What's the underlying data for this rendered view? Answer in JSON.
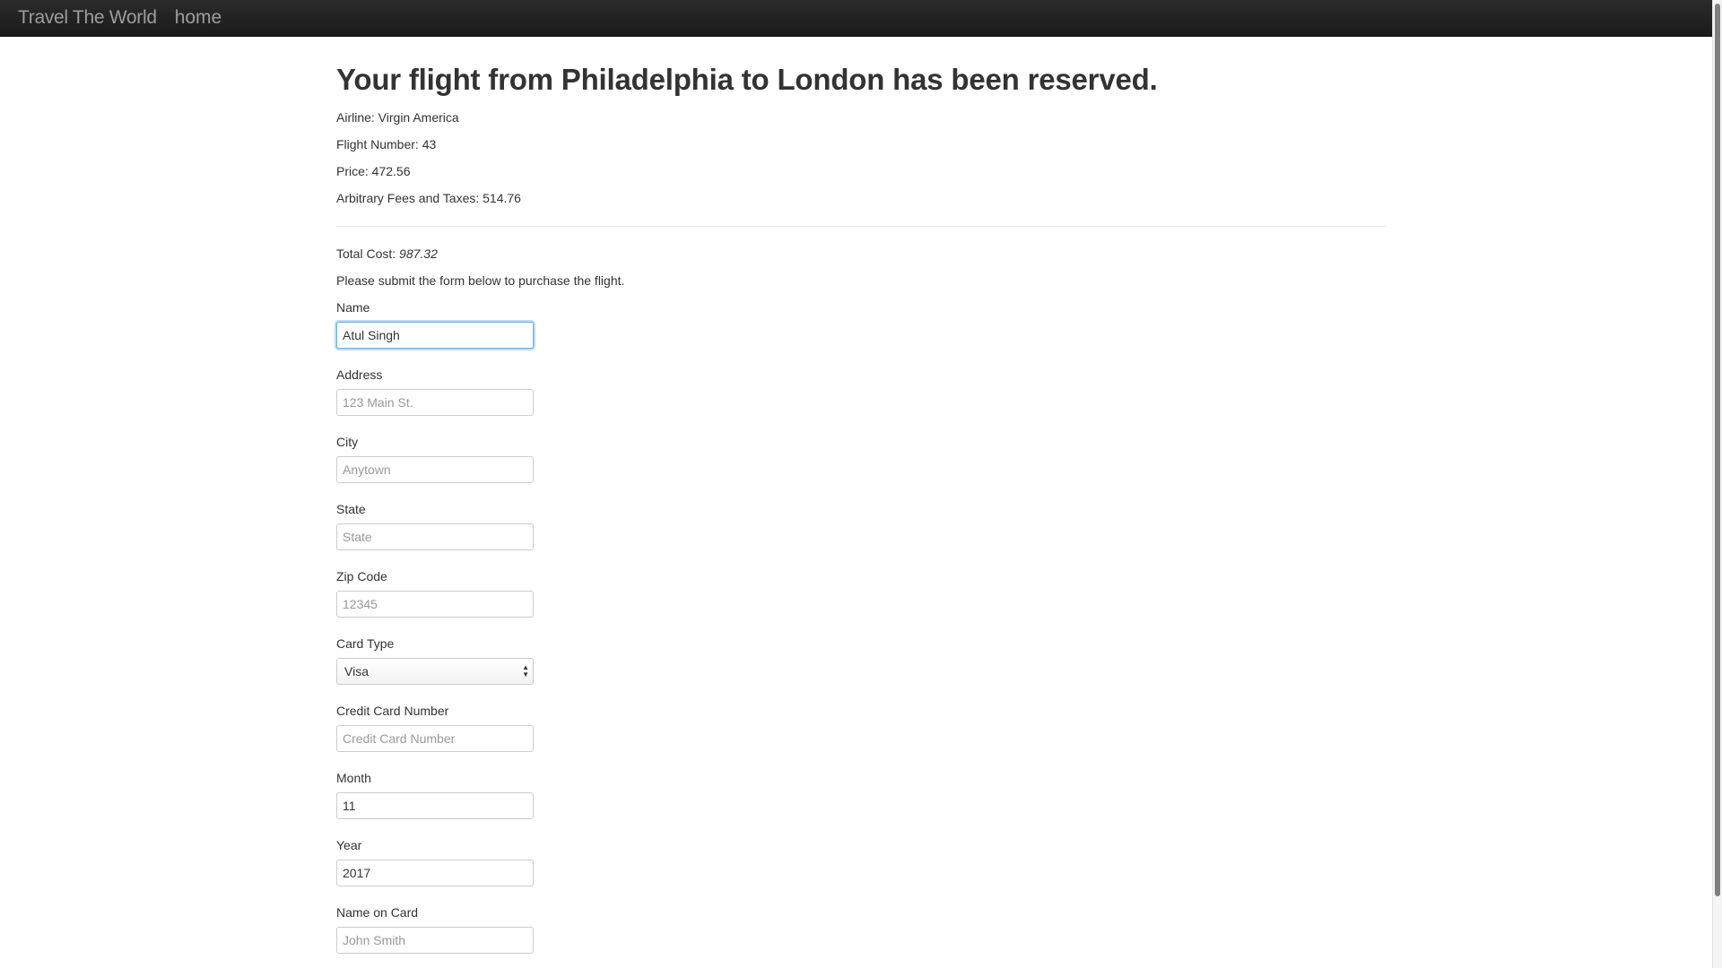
{
  "navbar": {
    "brand": "Travel The World",
    "home_link": "home"
  },
  "page": {
    "heading": "Your flight from Philadelphia to London has been reserved.",
    "airline": "Airline: Virgin America",
    "flight_number": "Flight Number: 43",
    "price": "Price: 472.56",
    "fees": "Arbitrary Fees and Taxes: 514.76",
    "total_label": "Total Cost: ",
    "total_value": "987.32",
    "instructions": "Please submit the form below to purchase the flight."
  },
  "form": {
    "name": {
      "label": "Name",
      "value": "Atul Singh",
      "placeholder": ""
    },
    "address": {
      "label": "Address",
      "value": "",
      "placeholder": "123 Main St."
    },
    "city": {
      "label": "City",
      "value": "",
      "placeholder": "Anytown"
    },
    "state": {
      "label": "State",
      "value": "",
      "placeholder": "State"
    },
    "zip": {
      "label": "Zip Code",
      "value": "",
      "placeholder": "12345"
    },
    "card_type": {
      "label": "Card Type",
      "selected": "Visa"
    },
    "card_number": {
      "label": "Credit Card Number",
      "value": "",
      "placeholder": "Credit Card Number"
    },
    "month": {
      "label": "Month",
      "value": "11",
      "placeholder": ""
    },
    "year": {
      "label": "Year",
      "value": "2017",
      "placeholder": ""
    },
    "name_on_card": {
      "label": "Name on Card",
      "value": "",
      "placeholder": "John Smith"
    }
  },
  "colors": {
    "navbar_bg": "#222222",
    "navbar_text": "#9d9d9d",
    "focus_border": "#66afe9"
  }
}
